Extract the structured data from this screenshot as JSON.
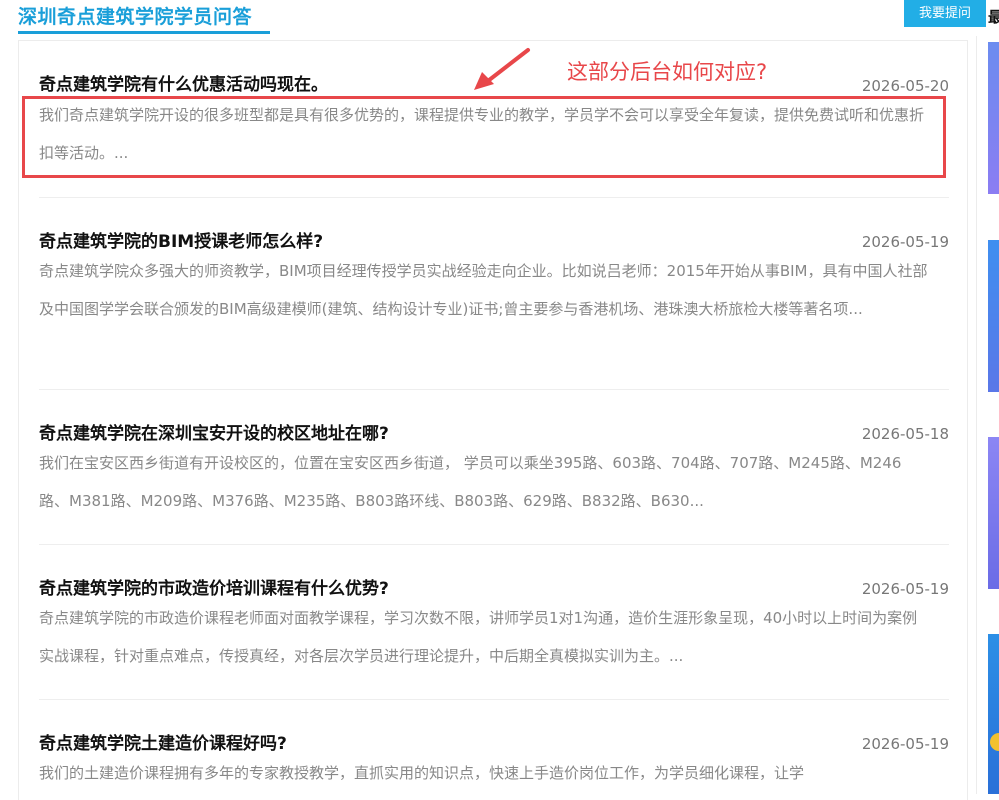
{
  "header": {
    "title": "深圳奇点建筑学院学员问答",
    "ask_button": "我要提问"
  },
  "annotation": {
    "text": "这部分后台如何对应?"
  },
  "right_column": {
    "label": "最"
  },
  "items": [
    {
      "title": "奇点建筑学院有什么优惠活动吗现在。",
      "date": "2026-05-20",
      "summary": "我们奇点建筑学院开设的很多班型都是具有很多优势的，课程提供专业的教学，学员学不会可以享受全年复读，提供免费试听和优惠折扣等活动。..."
    },
    {
      "title": "奇点建筑学院的BIM授课老师怎么样?",
      "date": "2026-05-19",
      "summary": "奇点建筑学院众多强大的师资教学，BIM项目经理传授学员实战经验走向企业。比如说吕老师：2015年开始从事BIM，具有中国人社部及中国图学学会联合颁发的BIM高级建模师(建筑、结构设计专业)证书;曾主要参与香港机场、港珠澳大桥旅检大楼等著名项..."
    },
    {
      "title": "奇点建筑学院在深圳宝安开设的校区地址在哪?",
      "date": "2026-05-18",
      "summary": "我们在宝安区西乡街道有开设校区的，位置在宝安区西乡街道， 学员可以乘坐395路、603路、704路、707路、M245路、M246路、M381路、M209路、M376路、M235路、B803路环线、B803路、629路、B832路、B630..."
    },
    {
      "title": "奇点建筑学院的市政造价培训课程有什么优势?",
      "date": "2026-05-19",
      "summary": "奇点建筑学院的市政造价课程老师面对面教学课程，学习次数不限，讲师学员1对1沟通，造价生涯形象呈现，40小时以上时间为案例实战课程，针对重点难点，传授真经，对各层次学员进行理论提升，中后期全真模拟实训为主。..."
    },
    {
      "title": "奇点建筑学院土建造价课程好吗?",
      "date": "2026-05-19",
      "summary": "我们的土建造价课程拥有多年的专家教授教学，直抓实用的知识点，快速上手造价岗位工作，为学员细化课程，让学"
    }
  ],
  "colors": {
    "accent": "#1a9fd9",
    "button": "#22aee6",
    "annotation": "#e8474a"
  }
}
